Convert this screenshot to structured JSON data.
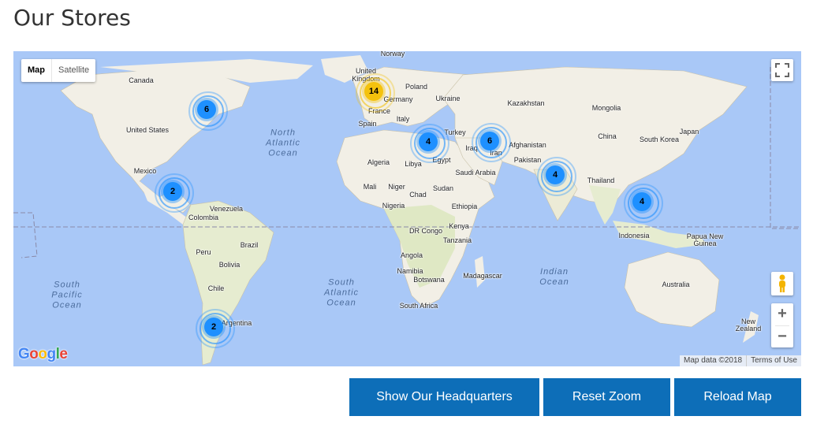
{
  "page": {
    "title": "Our Stores"
  },
  "map": {
    "type_control": {
      "map_label": "Map",
      "satellite_label": "Satellite"
    },
    "attribution": {
      "data": "Map data ©2018",
      "terms": "Terms of Use"
    },
    "logo": "Google",
    "zoom": {
      "in": "+",
      "out": "−"
    },
    "countries": {
      "norway": "Norway",
      "uk": "United\nKingdom",
      "poland": "Poland",
      "germany": "Germany",
      "ukraine": "Ukraine",
      "france": "France",
      "italy": "Italy",
      "spain": "Spain",
      "kazakhstan": "Kazakhstan",
      "mongolia": "Mongolia",
      "turkey": "Turkey",
      "afghanistan": "Afghanistan",
      "iraq": "Iraq",
      "iran": "Iran",
      "china": "China",
      "japan": "Japan",
      "south_korea": "South Korea",
      "pakistan": "Pakistan",
      "canada": "Canada",
      "united_states": "United States",
      "mexico": "Mexico",
      "algeria": "Algeria",
      "libya": "Libya",
      "egypt": "Egypt",
      "saudi_arabia": "Saudi Arabia",
      "mali": "Mali",
      "niger": "Niger",
      "chad": "Chad",
      "sudan": "Sudan",
      "nigeria": "Nigeria",
      "ethiopia": "Ethiopia",
      "thailand": "Thailand",
      "venezuela": "Venezuela",
      "colombia": "Colombia",
      "dr_congo": "DR Congo",
      "kenya": "Kenya",
      "tanzania": "Tanzania",
      "angola": "Angola",
      "namibia": "Namibia",
      "botswana": "Botswana",
      "madagascar": "Madagascar",
      "south_africa": "South Africa",
      "indonesia": "Indonesia",
      "papua": "Papua New\nGuinea",
      "peru": "Peru",
      "brazil": "Brazil",
      "bolivia": "Bolivia",
      "chile": "Chile",
      "argentina": "Argentina",
      "australia": "Australia",
      "new_zealand": "New\nZealand"
    },
    "oceans": {
      "north_atlantic": "North\nAtlantic\nOcean",
      "south_pacific": "South\nPacific\nOcean",
      "south_atlantic": "South\nAtlantic\nOcean",
      "indian": "Indian\nOcean"
    },
    "clusters": [
      {
        "count": "6",
        "color": "#1e90ff"
      },
      {
        "count": "14",
        "color": "#f4c20d"
      },
      {
        "count": "4",
        "color": "#1e90ff"
      },
      {
        "count": "6",
        "color": "#1e90ff"
      },
      {
        "count": "2",
        "color": "#1e90ff"
      },
      {
        "count": "4",
        "color": "#1e90ff"
      },
      {
        "count": "4",
        "color": "#1e90ff"
      },
      {
        "count": "2",
        "color": "#1e90ff"
      }
    ]
  },
  "actions": {
    "headquarters": "Show Our Headquarters",
    "reset_zoom": "Reset Zoom",
    "reload_map": "Reload Map"
  },
  "colors": {
    "button": "#0d6eb8",
    "water": "#a9c8f7",
    "land": "#f2efe6"
  }
}
